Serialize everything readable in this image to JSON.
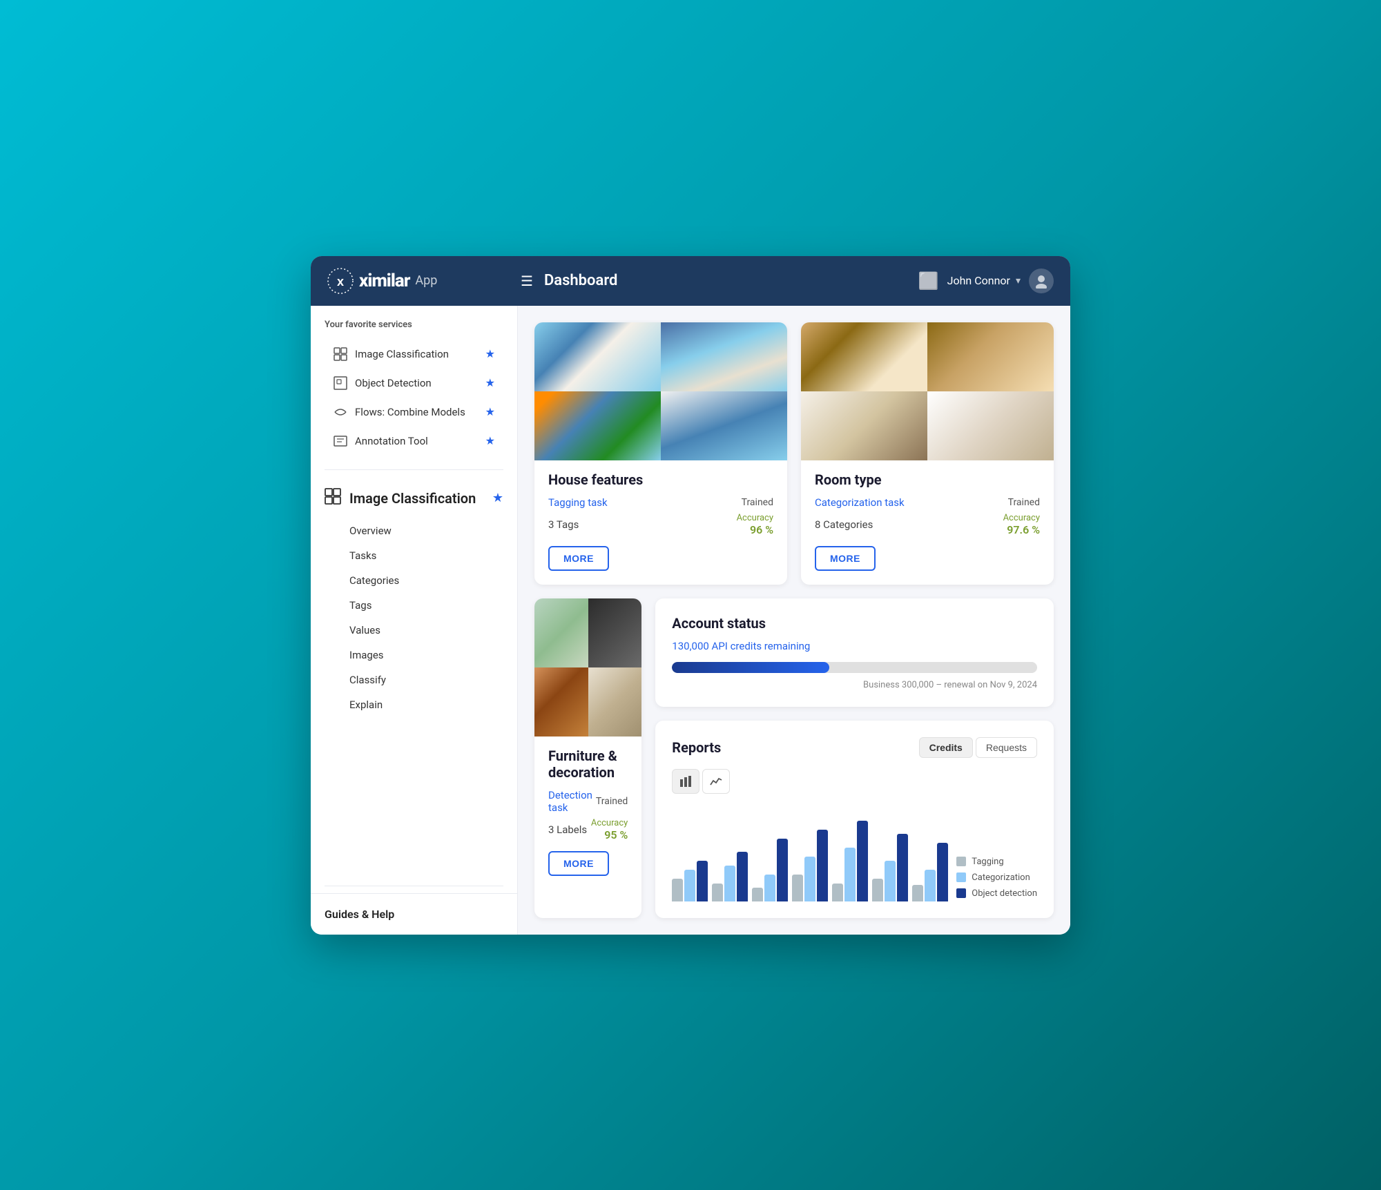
{
  "header": {
    "logo_brand": "ximilar",
    "logo_app": "App",
    "menu_icon": "☰",
    "title": "Dashboard",
    "monitor_icon": "🖥",
    "username": "John Connor",
    "chevron": "▾"
  },
  "sidebar": {
    "favorites_title": "Your favorite services",
    "favorites": [
      {
        "label": "Image Classification",
        "icon": "grid"
      },
      {
        "label": "Object Detection",
        "icon": "box"
      },
      {
        "label": "Flows: Combine Models",
        "icon": "flows"
      },
      {
        "label": "Annotation Tool",
        "icon": "annotation"
      }
    ],
    "active_section": {
      "icon": "grid",
      "name": "Image Classification",
      "nav_items": [
        "Overview",
        "Tasks",
        "Categories",
        "Tags",
        "Values",
        "Images",
        "Classify",
        "Explain"
      ]
    },
    "guides_label": "Guides & Help"
  },
  "cards": [
    {
      "id": "house-features",
      "title": "House features",
      "task_link": "Tagging task",
      "status": "Trained",
      "count_label": "3 Tags",
      "accuracy_label": "Accuracy",
      "accuracy_value": "96 %",
      "more_label": "MORE",
      "images": [
        "house-img-1",
        "house-img-2",
        "house-img-3",
        "house-img-4"
      ]
    },
    {
      "id": "room-type",
      "title": "Room type",
      "task_link": "Categorization task",
      "status": "Trained",
      "count_label": "8 Categories",
      "accuracy_label": "Accuracy",
      "accuracy_value": "97.6 %",
      "more_label": "MORE",
      "images": [
        "room-img-1",
        "room-img-2",
        "room-img-3",
        "room-img-4"
      ]
    },
    {
      "id": "furniture",
      "title": "Furniture & decoration",
      "task_link": "Detection task",
      "status": "Trained",
      "count_label": "3 Labels",
      "accuracy_label": "Accuracy",
      "accuracy_value": "95 %",
      "more_label": "MORE",
      "images": [
        "furn-img-1",
        "furn-img-2",
        "furn-img-3",
        "furn-img-4"
      ]
    }
  ],
  "account_status": {
    "title": "Account status",
    "credits_text": "130,000 API credits remaining",
    "progress_percent": 43,
    "plan_text": "Business 300,000 – renewal on Nov 9, 2024"
  },
  "reports": {
    "title": "Reports",
    "tabs": [
      "Credits",
      "Requests"
    ],
    "active_tab": "Credits",
    "view_bar_icon": "▐▌",
    "view_line_icon": "∿",
    "legend": [
      {
        "key": "tagging",
        "label": "Tagging",
        "color_class": "dot-tagging"
      },
      {
        "key": "categorization",
        "label": "Categorization",
        "color_class": "dot-categorization"
      },
      {
        "key": "detection",
        "label": "Object detection",
        "color_class": "dot-detection"
      }
    ],
    "bars": [
      {
        "tagging": 25,
        "categorization": 35,
        "detection": 45
      },
      {
        "tagging": 20,
        "categorization": 40,
        "detection": 55
      },
      {
        "tagging": 15,
        "categorization": 30,
        "detection": 70
      },
      {
        "tagging": 30,
        "categorization": 50,
        "detection": 80
      },
      {
        "tagging": 20,
        "categorization": 60,
        "detection": 90
      },
      {
        "tagging": 25,
        "categorization": 45,
        "detection": 75
      },
      {
        "tagging": 18,
        "categorization": 35,
        "detection": 65
      }
    ]
  }
}
